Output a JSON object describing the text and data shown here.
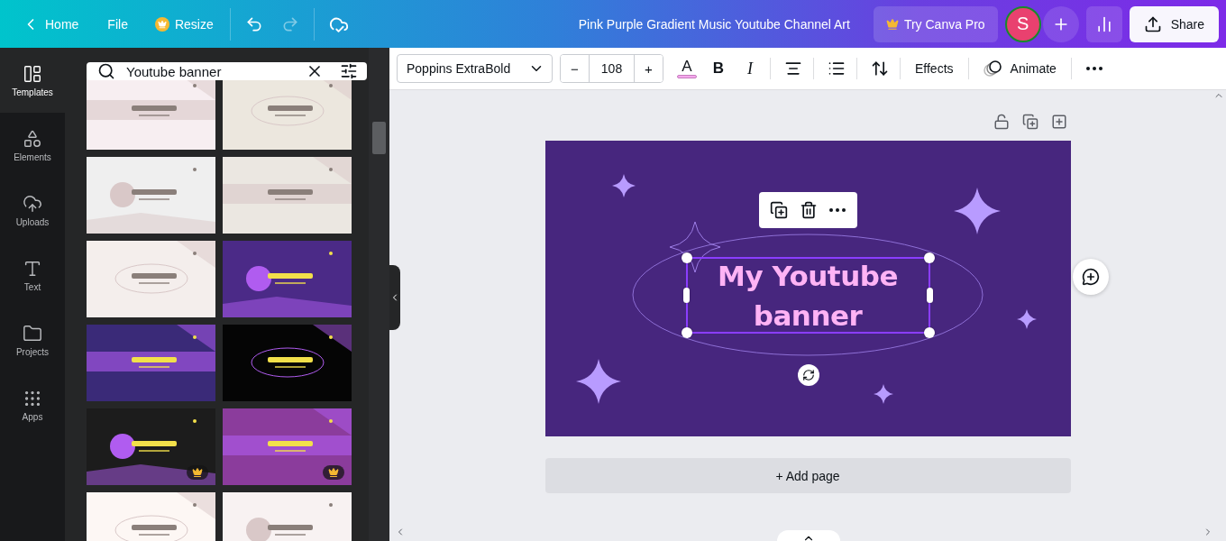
{
  "topbar": {
    "back": "Home",
    "file": "File",
    "resize": "Resize",
    "title": "Pink Purple Gradient Music Youtube Channel Art",
    "pro_button": "Try Canva Pro",
    "avatar": "S",
    "share": "Share"
  },
  "sidebar": {
    "items": [
      {
        "label": "Templates",
        "selected": true
      },
      {
        "label": "Elements",
        "selected": false
      },
      {
        "label": "Uploads",
        "selected": false
      },
      {
        "label": "Text",
        "selected": false
      },
      {
        "label": "Projects",
        "selected": false
      },
      {
        "label": "Apps",
        "selected": false
      }
    ]
  },
  "search": {
    "value": "Youtube banner"
  },
  "templates": [
    {
      "kind": "picture",
      "color": "#f7eef1",
      "pro": false
    },
    {
      "kind": "picture",
      "color": "#ece7de",
      "pro": false
    },
    {
      "kind": "picture",
      "color": "#efefef",
      "pro": false
    },
    {
      "kind": "picture",
      "color": "#ebe7e1",
      "pro": false
    },
    {
      "kind": "picture",
      "color": "#f4eeec",
      "pro": false
    },
    {
      "kind": "picture",
      "color": "#4b2a87",
      "pro": false
    },
    {
      "kind": "picture",
      "color": "#3a2a78",
      "pro": false
    },
    {
      "kind": "picture",
      "color": "#050505",
      "pro": false
    },
    {
      "kind": "picture",
      "color": "#1c1c1c",
      "pro": true
    },
    {
      "kind": "picture",
      "color": "#8b3c9c",
      "pro": true
    },
    {
      "kind": "picture",
      "color": "#fdf7f4",
      "pro": false
    },
    {
      "kind": "picture",
      "color": "#f8f2f2",
      "pro": false
    }
  ],
  "toolbar": {
    "font": "Poppins ExtraBold",
    "decrease": "−",
    "size": "108",
    "increase": "+",
    "color_letter": "A",
    "bold": "B",
    "italic": "I",
    "effects": "Effects",
    "animate": "Animate"
  },
  "design": {
    "text": "My Youtube banner",
    "selected": true
  },
  "add_page": "+ Add page"
}
